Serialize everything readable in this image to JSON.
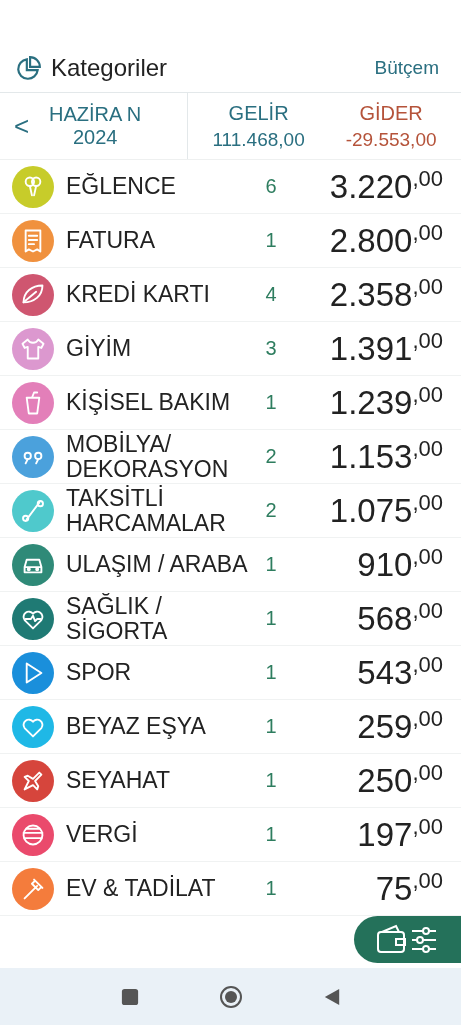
{
  "header": {
    "title": "Kategoriler",
    "link": "Bütçem"
  },
  "period": {
    "prev": "<",
    "label": "HAZİRA N 2024",
    "income_label": "GELİR",
    "income": "111.468,00",
    "expense_label": "GİDER",
    "expense": "-29.553,00"
  },
  "categories": [
    {
      "name": "EĞLENCE",
      "count": "6",
      "amount": "3.220$^{,00}$",
      "color": "#c7cc2a"
    },
    {
      "name": "FATURA",
      "count": "1",
      "amount": "2.800$^{,00}$",
      "color": "#f0913e"
    },
    {
      "name": "KREDİ KARTI",
      "count": "4",
      "amount": "2.358$^{,00}$",
      "color": "#cf5670"
    },
    {
      "name": "GİYİM",
      "count": "3",
      "amount": "1.391$^{,00}$",
      "color": "#dc98cf"
    },
    {
      "name": "KİŞİSEL BAKIM",
      "count": "1",
      "amount": "1.239$^{,00}$",
      "color": "#e37fb9"
    },
    {
      "name": "MOBİLYA/ DEKORASYON",
      "count": "2",
      "amount": "1.153$^{,00}$",
      "color": "#4ba1dc"
    },
    {
      "name": "TAKSİTLİ HARCAMALAR",
      "count": "2",
      "amount": "1.075$^{,00}$",
      "color": "#4fc9cc"
    },
    {
      "name": "ULAŞIM / ARABA",
      "count": "1",
      "amount": "910$^{,00}$",
      "color": "#2f8a78"
    },
    {
      "name": "SAĞLIK / SİGORTA",
      "count": "1",
      "amount": "568$^{,00}$",
      "color": "#1f7a74"
    },
    {
      "name": "SPOR",
      "count": "1",
      "amount": "543$^{,00}$",
      "color": "#1a8fdb"
    },
    {
      "name": "BEYAZ EŞYA",
      "count": "1",
      "amount": "259$^{,00}$",
      "color": "#1fb8e6"
    },
    {
      "name": "SEYAHAT",
      "count": "1",
      "amount": "250$^{,00}$",
      "color": "#d6453c"
    },
    {
      "name": "VERGİ",
      "count": "1",
      "amount": "197$^{,00}$",
      "color": "#ea4a6c"
    },
    {
      "name": "EV & TADİLAT",
      "count": "1",
      "amount": "75$^{,00}$",
      "color": "#f47c3c"
    }
  ]
}
